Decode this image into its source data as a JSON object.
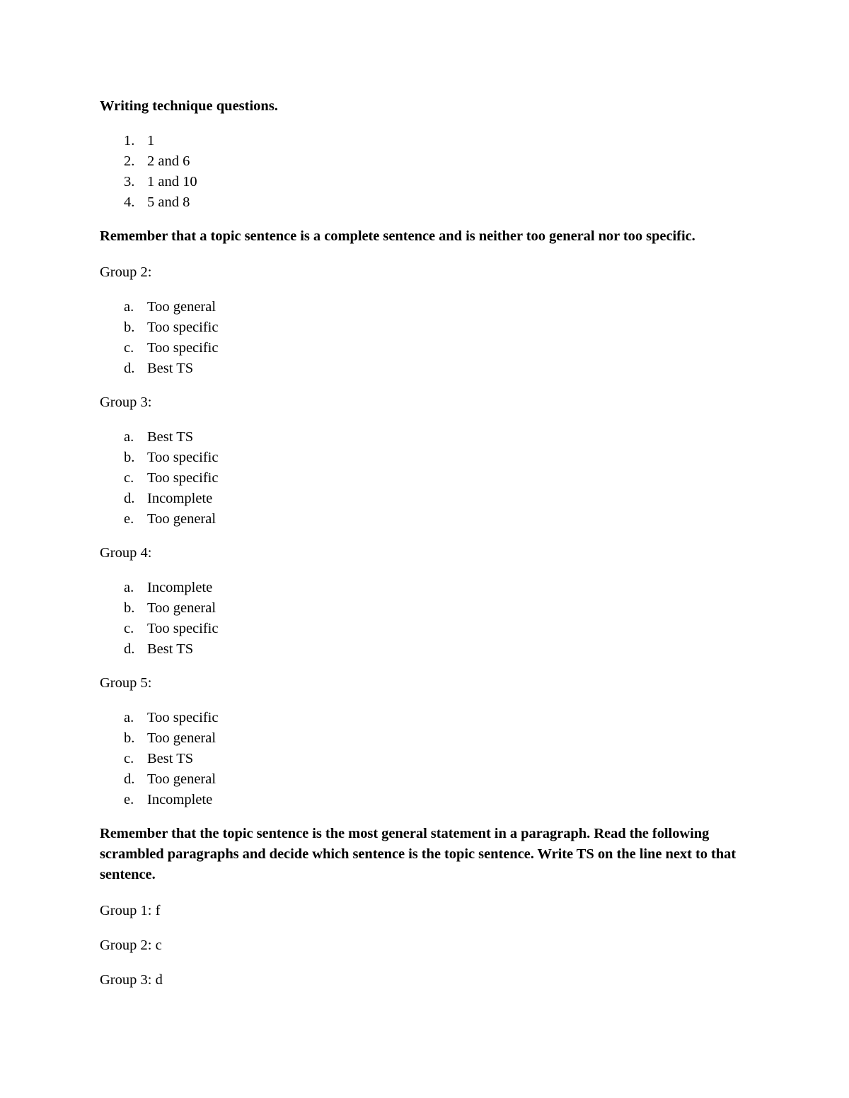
{
  "document": {
    "title_line": "Writing technique questions.",
    "sections": [
      {
        "id": "writing-technique",
        "heading": "Writing technique questions.",
        "list_style": "decimal",
        "items": [
          {
            "marker": "1.",
            "text": "1"
          },
          {
            "marker": "2.",
            "text": "2 and 6"
          },
          {
            "marker": "3.",
            "text": "1 and 10"
          },
          {
            "marker": "4.",
            "text": "5 and 8"
          }
        ]
      }
    ],
    "reminder_one": "Remember that a topic sentence is a complete sentence and is neither too general nor too specific.",
    "groups": [
      {
        "id": "group-2",
        "label": "Group 2:",
        "items": [
          {
            "marker": "a.",
            "text": "Too general"
          },
          {
            "marker": "b.",
            "text": "Too specific"
          },
          {
            "marker": "c.",
            "text": "Too specific"
          },
          {
            "marker": "d.",
            "text": "Best TS"
          }
        ]
      },
      {
        "id": "group-3",
        "label": "Group 3:",
        "items": [
          {
            "marker": "a.",
            "text": "Best TS"
          },
          {
            "marker": "b.",
            "text": "Too specific"
          },
          {
            "marker": "c.",
            "text": "Too specific"
          },
          {
            "marker": "d.",
            "text": "Incomplete"
          },
          {
            "marker": "e.",
            "text": "Too general"
          }
        ]
      },
      {
        "id": "group-4",
        "label": "Group 4:",
        "items": [
          {
            "marker": "a.",
            "text": "Incomplete"
          },
          {
            "marker": "b.",
            "text": "Too general"
          },
          {
            "marker": "c.",
            "text": "Too specific"
          },
          {
            "marker": "d.",
            "text": "Best TS"
          }
        ]
      },
      {
        "id": "group-5",
        "label": "Group 5:",
        "items": [
          {
            "marker": "a.",
            "text": "Too specific"
          },
          {
            "marker": "b.",
            "text": "Too general"
          },
          {
            "marker": "c.",
            "text": "Best TS"
          },
          {
            "marker": "d.",
            "text": "Too general"
          },
          {
            "marker": "e.",
            "text": "Incomplete"
          }
        ]
      }
    ],
    "reminder_two": "Remember that the topic sentence is the most general statement in a paragraph. Read the following scrambled paragraphs and decide which sentence is the topic sentence. Write TS on the line next to that sentence.",
    "answers": [
      {
        "id": "answer-group-1",
        "text": "Group 1: f"
      },
      {
        "id": "answer-group-2",
        "text": "Group 2: c"
      },
      {
        "id": "answer-group-3",
        "text": "Group 3: d"
      }
    ]
  }
}
